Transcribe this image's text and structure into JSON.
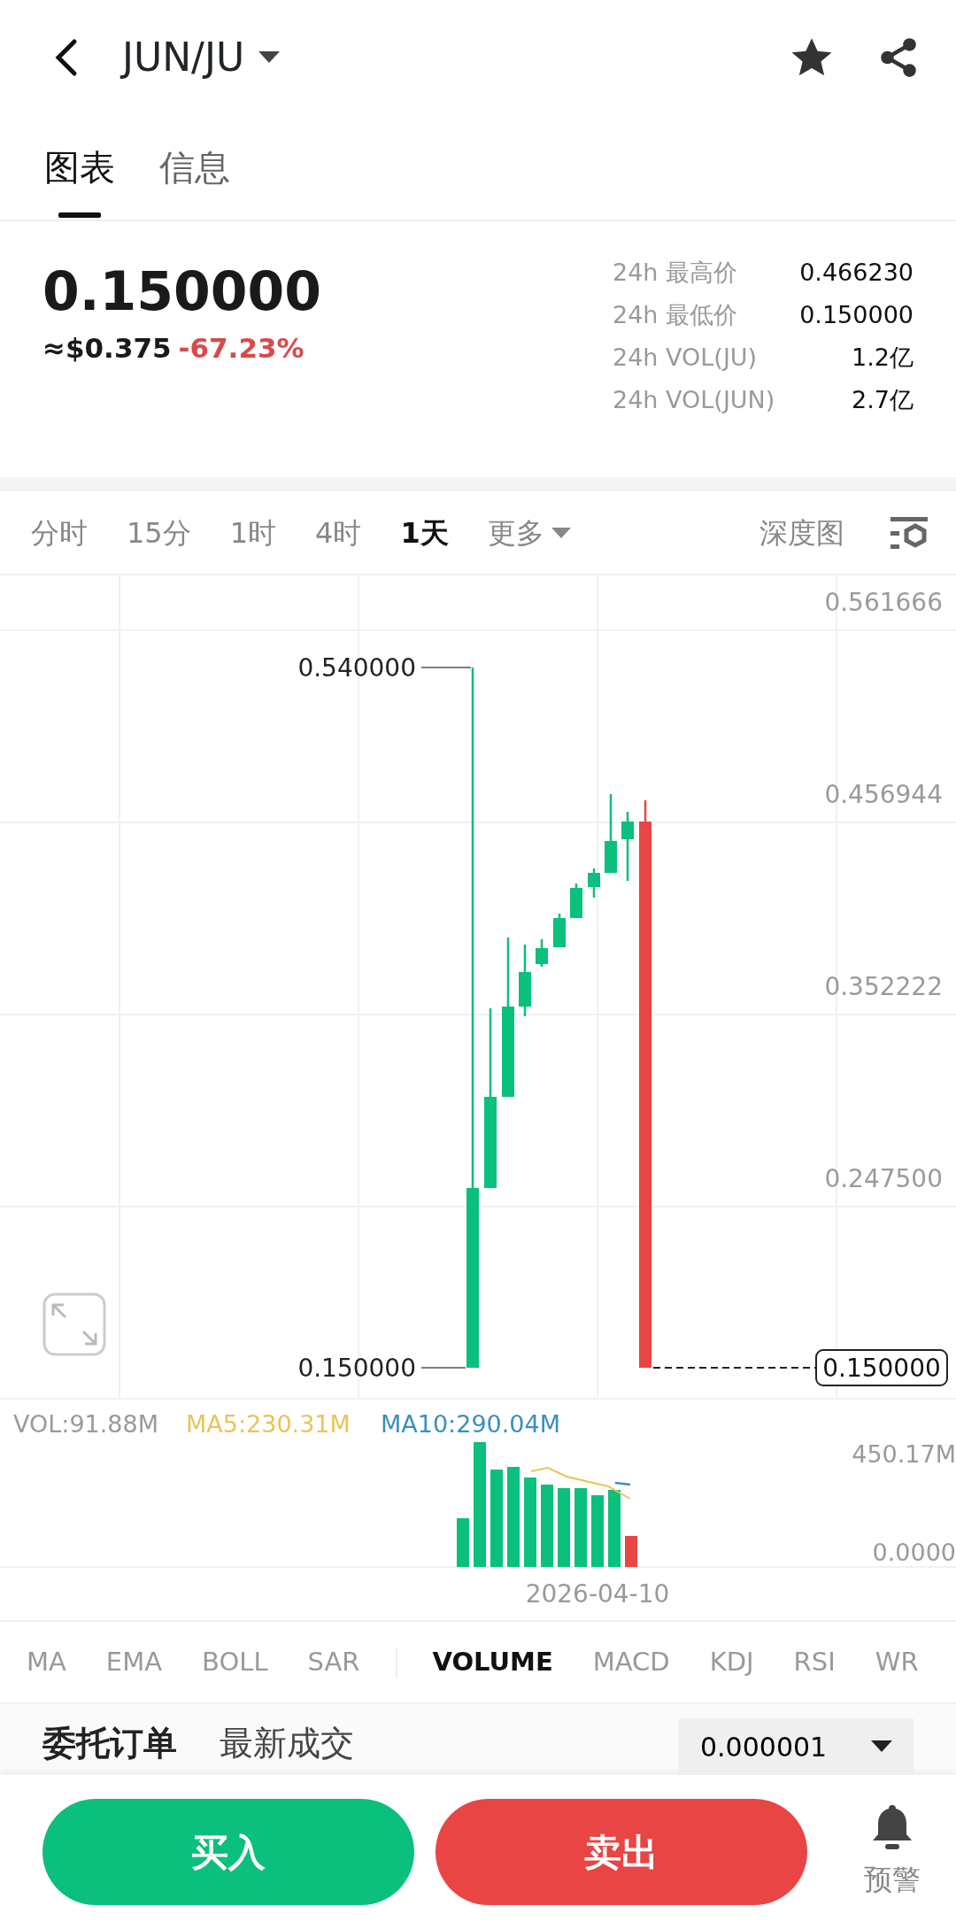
{
  "header": {
    "title": "JUN/JU"
  },
  "tabs": [
    {
      "label": "图表",
      "selected": true
    },
    {
      "label": "信息",
      "selected": false
    }
  ],
  "price": {
    "last": "0.150000",
    "usd": "≈$0.375",
    "change": "-67.23%"
  },
  "stats": [
    {
      "label": "24h 最高价",
      "value": "0.466230"
    },
    {
      "label": "24h 最低价",
      "value": "0.150000"
    },
    {
      "label": "24h VOL(JU)",
      "value": "1.2亿"
    },
    {
      "label": "24h VOL(JUN)",
      "value": "2.7亿"
    }
  ],
  "timeframes": [
    {
      "label": "分时",
      "selected": false
    },
    {
      "label": "15分",
      "selected": false
    },
    {
      "label": "1时",
      "selected": false
    },
    {
      "label": "4时",
      "selected": false
    },
    {
      "label": "1天",
      "selected": true
    },
    {
      "label": "更多",
      "selected": false,
      "kind": "dropdown"
    }
  ],
  "depth_chart": "深度图",
  "chart": {
    "y_labels": [
      "0.561666",
      "0.456944",
      "0.352222",
      "0.247500"
    ],
    "high_label": "0.540000",
    "low_label": "0.150000",
    "current_price": "0.150000"
  },
  "volume": {
    "legend": [
      {
        "text": "VOL:91.88M",
        "color": "#9a9a9a"
      },
      {
        "text": "MA5:230.31M",
        "color": "#e8c45a"
      },
      {
        "text": "MA10:290.04M",
        "color": "#3b8fbf"
      }
    ],
    "y_labels": [
      "450.17M",
      "0.0000"
    ],
    "date": "2026-04-10"
  },
  "indicators": [
    {
      "label": "MA",
      "selected": false
    },
    {
      "label": "EMA",
      "selected": false
    },
    {
      "label": "BOLL",
      "selected": false
    },
    {
      "label": "SAR",
      "selected": false
    },
    {
      "label": "VOLUME",
      "selected": true
    },
    {
      "label": "MACD",
      "selected": false
    },
    {
      "label": "KDJ",
      "selected": false
    },
    {
      "label": "RSI",
      "selected": false
    },
    {
      "label": "WR",
      "selected": false
    }
  ],
  "orderbook": {
    "tabs": [
      "委托订单",
      "最新成交"
    ],
    "precision": "0.000001"
  },
  "actions": {
    "buy": "买入",
    "sell": "卖出",
    "alert": "预警"
  }
}
